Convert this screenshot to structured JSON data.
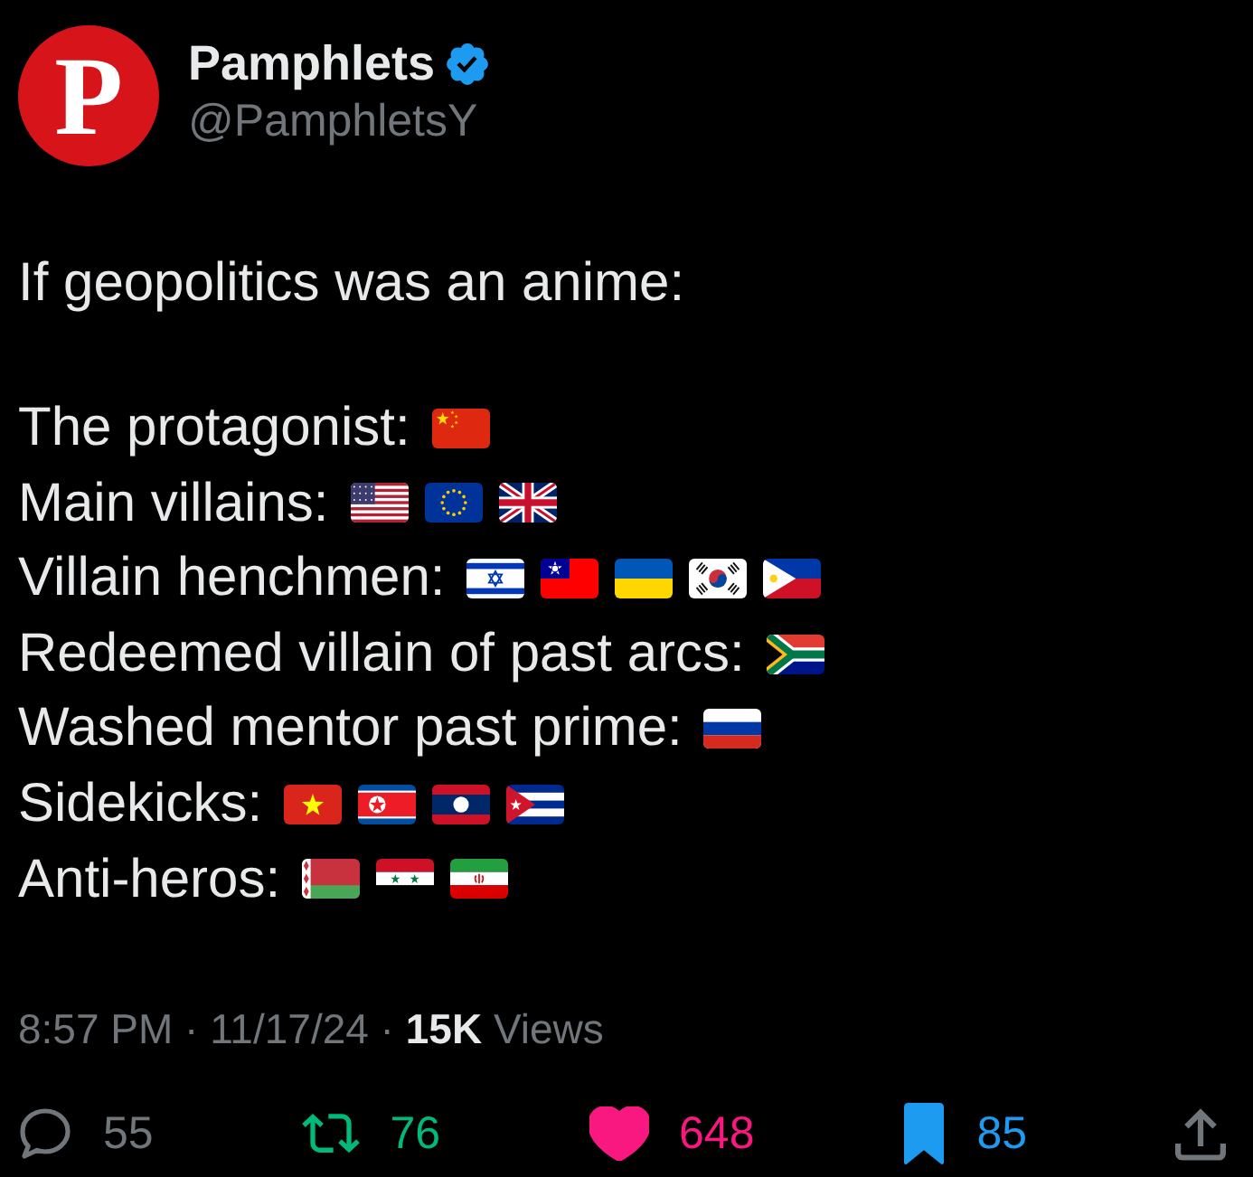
{
  "author": {
    "logo_text": "P",
    "name": "Pamphlets",
    "verified": true,
    "handle": "@PamphletsY"
  },
  "post": {
    "intro": "If geopolitics was an anime:",
    "lines": [
      {
        "label": "The protagonist:",
        "flags": [
          {
            "kind": "china"
          }
        ]
      },
      {
        "label": "Main villains:",
        "flags": [
          {
            "kind": "usa"
          },
          {
            "kind": "eu"
          },
          {
            "kind": "uk"
          }
        ]
      },
      {
        "label": "Villain henchmen:",
        "flags": [
          {
            "kind": "israel"
          },
          {
            "kind": "taiwan"
          },
          {
            "kind": "ukraine"
          },
          {
            "kind": "southkorea"
          },
          {
            "kind": "philippines"
          }
        ]
      },
      {
        "label": "Redeemed villain of past arcs:",
        "flags": [
          {
            "kind": "southafrica"
          }
        ]
      },
      {
        "label": "Washed mentor past prime:",
        "flags": [
          {
            "kind": "russia"
          }
        ]
      },
      {
        "label": "Sidekicks:",
        "flags": [
          {
            "kind": "vietnam"
          },
          {
            "kind": "northkorea"
          },
          {
            "kind": "laos"
          },
          {
            "kind": "cuba"
          }
        ]
      },
      {
        "label": "Anti-heros:",
        "flags": [
          {
            "kind": "belarus"
          },
          {
            "kind": "syria"
          },
          {
            "kind": "iran"
          }
        ]
      }
    ]
  },
  "meta": "8:57 PM · 11/17/24 · **15K** Views",
  "actions": [
    {
      "kind": "reply",
      "count": "55",
      "active": false
    },
    {
      "kind": "repost",
      "count": "76",
      "active": true
    },
    {
      "kind": "like",
      "count": "648",
      "active": true
    },
    {
      "kind": "bookmark",
      "count": "85",
      "active": true
    },
    {
      "kind": "share"
    }
  ]
}
